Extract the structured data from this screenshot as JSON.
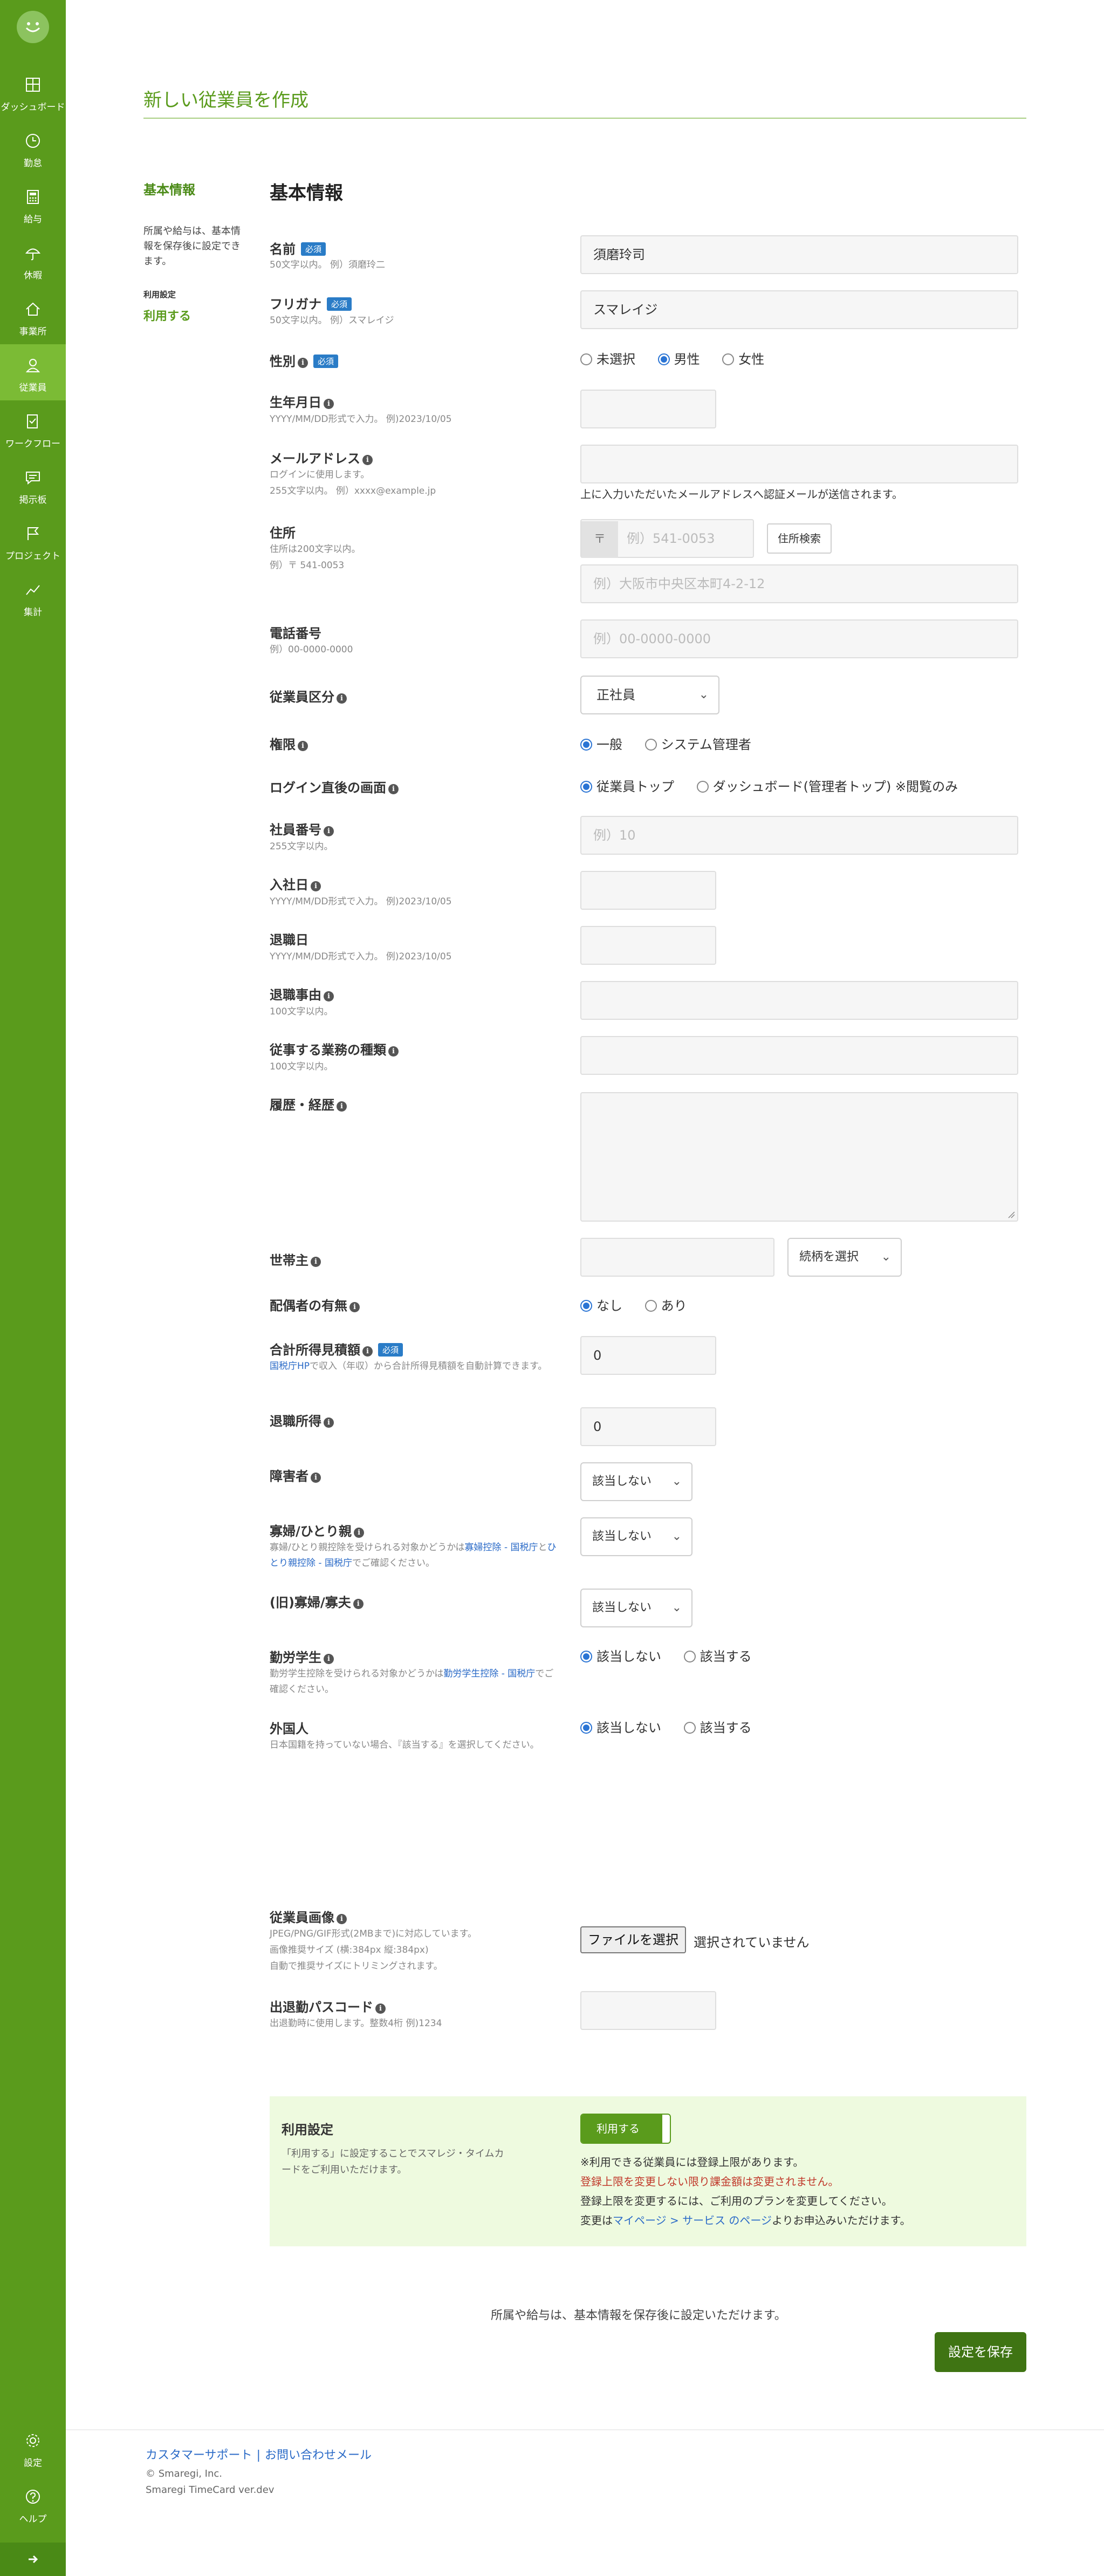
{
  "sidebar": {
    "items": [
      {
        "label": "ダッシュボード",
        "icon": "dashboard-icon"
      },
      {
        "label": "勤怠",
        "icon": "clock-icon"
      },
      {
        "label": "給与",
        "icon": "calculator-icon"
      },
      {
        "label": "休暇",
        "icon": "umbrella-icon"
      },
      {
        "label": "事業所",
        "icon": "home-icon"
      },
      {
        "label": "従業員",
        "icon": "person-icon",
        "active": true
      },
      {
        "label": "ワークフロー",
        "icon": "checklist-icon"
      },
      {
        "label": "掲示板",
        "icon": "chat-icon"
      },
      {
        "label": "プロジェクト",
        "icon": "flag-icon"
      },
      {
        "label": "集計",
        "icon": "chart-icon"
      }
    ],
    "settings_label": "設定",
    "help_label": "ヘルプ"
  },
  "page": {
    "title": "新しい従業員を作成",
    "side_heading": "基本情報",
    "side_note": "所属や給与は、基本情報を保存後に設定できます。",
    "side_usage_label": "利用設定",
    "side_usage_link": "利用する",
    "section_title": "基本情報"
  },
  "form": {
    "required_badge": "必須",
    "name": {
      "label": "名前",
      "help": "50文字以内。 例）須磨玲二",
      "value": "須磨玲司"
    },
    "furigana": {
      "label": "フリガナ",
      "help": "50文字以内。 例）スマレイジ",
      "value": "スマレイジ"
    },
    "gender": {
      "label": "性別",
      "options": [
        "未選択",
        "男性",
        "女性"
      ],
      "selected": "男性"
    },
    "birthday": {
      "label": "生年月日",
      "help": "YYYY/MM/DD形式で入力。 例)2023/10/05"
    },
    "email": {
      "label": "メールアドレス",
      "help1": "ログインに使用します。",
      "help2": "255文字以内。 例）xxxx@example.jp",
      "note": "上に入力いただいたメールアドレスへ認証メールが送信されます。"
    },
    "address": {
      "label": "住所",
      "help1": "住所は200文字以内。",
      "help2": "例）〒 541-0053",
      "postal_mark": "〒",
      "postal_placeholder": "例）541-0053",
      "search_button": "住所検索",
      "address_placeholder": "例）大阪市中央区本町4-2-12"
    },
    "phone": {
      "label": "電話番号",
      "help": "例）00-0000-0000",
      "placeholder": "例）00-0000-0000"
    },
    "employee_type": {
      "label": "従業員区分",
      "value": "正社員"
    },
    "permission": {
      "label": "権限",
      "options": [
        "一般",
        "システム管理者"
      ],
      "selected": "一般"
    },
    "landing": {
      "label": "ログイン直後の画面",
      "options": [
        "従業員トップ",
        "ダッシュボード(管理者トップ) ※閲覧のみ"
      ],
      "selected": "従業員トップ"
    },
    "employee_no": {
      "label": "社員番号",
      "help": "255文字以内。",
      "placeholder": "例）10"
    },
    "join_date": {
      "label": "入社日",
      "help": "YYYY/MM/DD形式で入力。 例)2023/10/05"
    },
    "leave_date": {
      "label": "退職日",
      "help": "YYYY/MM/DD形式で入力。 例)2023/10/05"
    },
    "leave_reason": {
      "label": "退職事由",
      "help": "100文字以内。"
    },
    "job_type": {
      "label": "従事する業務の種類",
      "help": "100文字以内。"
    },
    "history": {
      "label": "履歴・経歴"
    },
    "householder": {
      "label": "世帯主",
      "relation_placeholder": "続柄を選択"
    },
    "spouse": {
      "label": "配偶者の有無",
      "options": [
        "なし",
        "あり"
      ],
      "selected": "なし"
    },
    "income_estimate": {
      "label": "合計所得見積額",
      "help_link": "国税庁HP",
      "help_rest": "で収入（年収）から合計所得見積額を自動計算できます。",
      "value": "0"
    },
    "retirement_income": {
      "label": "退職所得",
      "value": "0"
    },
    "disability": {
      "label": "障害者",
      "value": "該当しない"
    },
    "widow": {
      "label": "寡婦/ひとり親",
      "help_a": "寡婦/ひとり親控除を受けられる対象かどうかは",
      "help_link1": "寡婦控除 - 国税庁",
      "help_b": "と",
      "help_link2": "ひとり親控除 - 国税庁",
      "help_c": "でご確認ください。",
      "value": "該当しない"
    },
    "old_widow": {
      "label": "(旧)寡婦/寡夫",
      "value": "該当しない"
    },
    "working_student": {
      "label": "勤労学生",
      "help_a": "勤労学生控除を受けられる対象かどうかは",
      "help_link": "勤労学生控除 - 国税庁",
      "help_b": "でご確認ください。",
      "options": [
        "該当しない",
        "該当する"
      ],
      "selected": "該当しない"
    },
    "foreigner": {
      "label": "外国人",
      "help": "日本国籍を持っていない場合、『該当する』を選択してください。",
      "options": [
        "該当しない",
        "該当する"
      ],
      "selected": "該当しない"
    },
    "photo": {
      "label": "従業員画像",
      "help1": "JPEG/PNG/GIF形式(2MBまで)に対応しています。",
      "help2": "画像推奨サイズ (横:384px 縦:384px)",
      "help3": "自動で推奨サイズにトリミングされます。",
      "button": "ファイルを選択",
      "status": "選択されていません"
    },
    "passcode": {
      "label": "出退勤パスコード",
      "help": "出退勤時に使用します。整数4桁 例)1234"
    }
  },
  "usage": {
    "title": "利用設定",
    "desc": "「利用する」に設定することでスマレジ・タイムカードをご利用いただけます。",
    "toggle_label": "利用する",
    "line1": "※利用できる従業員には登録上限があります。",
    "line2": "登録上限を変更しない限り課金額は変更されません。",
    "line3": "登録上限を変更するには、ご利用のプランを変更してください。",
    "line4_a": "変更は",
    "line4_link": "マイページ > サービス のページ",
    "line4_b": "よりお申込みいただけます。"
  },
  "bottom_note": "所属や給与は、基本情報を保存後に設定いただけます。",
  "save_button": "設定を保存",
  "footer": {
    "support_link": "カスタマーサポート",
    "separator": "|",
    "contact_link": "お問い合わせメール",
    "copyright": "© Smaregi, Inc.",
    "version": "Smaregi TimeCard ver.dev"
  }
}
